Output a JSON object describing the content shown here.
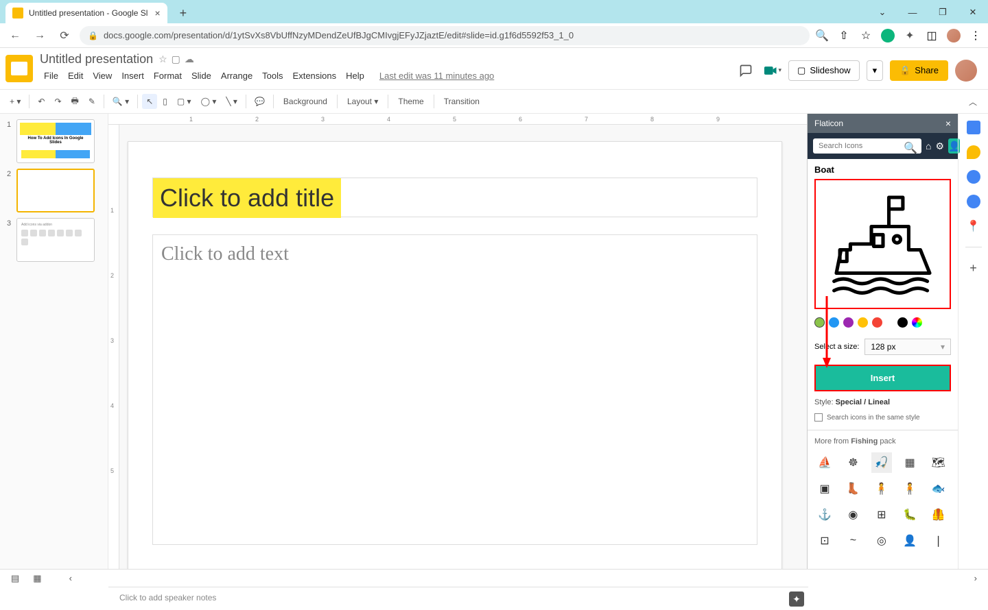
{
  "browser": {
    "tab_title": "Untitled presentation - Google Sl",
    "url": "docs.google.com/presentation/d/1ytSvXs8VbUffNzyMDendZeUfBJgCMIvgjEFyJZjaztE/edit#slide=id.g1f6d5592f53_1_0"
  },
  "header": {
    "doc_title": "Untitled presentation",
    "last_edit": "Last edit was 11 minutes ago",
    "slideshow_btn": "Slideshow",
    "share_btn": "Share"
  },
  "menus": {
    "file": "File",
    "edit": "Edit",
    "view": "View",
    "insert": "Insert",
    "format": "Format",
    "slide": "Slide",
    "arrange": "Arrange",
    "tools": "Tools",
    "extensions": "Extensions",
    "help": "Help"
  },
  "toolbar": {
    "background": "Background",
    "layout": "Layout",
    "theme": "Theme",
    "transition": "Transition"
  },
  "slide": {
    "title_placeholder": "Click to add title",
    "body_placeholder": "Click to add text"
  },
  "thumbnails": {
    "thumb1_text": "How To Add Icons In Google Slides"
  },
  "speaker_notes": "Click to add speaker notes",
  "flaticon": {
    "title": "Flaticon",
    "search_placeholder": "Search Icons",
    "icon_name": "Boat",
    "size_label": "Select a size:",
    "size_value": "128 px",
    "insert_btn": "Insert",
    "style_label": "Style:",
    "style_value": "Special / Lineal",
    "checkbox_label": "Search icons in the same style",
    "more_from_prefix": "More from ",
    "more_from_pack": "Fishing",
    "more_from_suffix": " pack"
  },
  "ruler_marks": {
    "h": [
      "1",
      "2",
      "3",
      "4",
      "5",
      "6",
      "7",
      "8",
      "9"
    ],
    "v": [
      "1",
      "2",
      "3",
      "4",
      "5"
    ]
  }
}
